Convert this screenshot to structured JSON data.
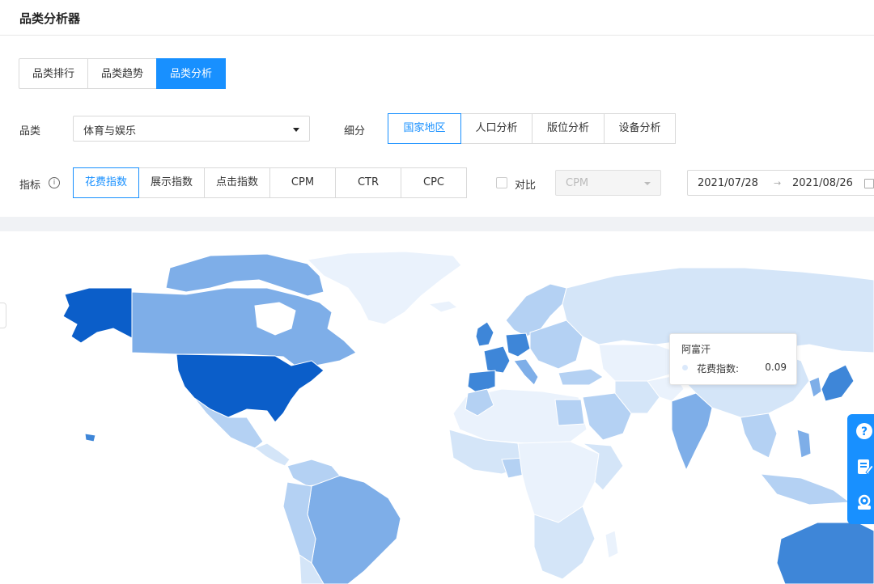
{
  "header": {
    "title": "品类分析器"
  },
  "tabs": [
    {
      "label": "品类排行",
      "active": false
    },
    {
      "label": "品类趋势",
      "active": false
    },
    {
      "label": "品类分析",
      "active": true
    }
  ],
  "category": {
    "label": "品类",
    "value": "体育与娱乐"
  },
  "breakdown": {
    "label": "细分",
    "options": [
      {
        "label": "国家地区",
        "active": true
      },
      {
        "label": "人口分析",
        "active": false
      },
      {
        "label": "版位分析",
        "active": false
      },
      {
        "label": "设备分析",
        "active": false
      }
    ]
  },
  "metric": {
    "label": "指标",
    "options": [
      {
        "label": "花费指数",
        "active": true
      },
      {
        "label": "展示指数",
        "active": false
      },
      {
        "label": "点击指数",
        "active": false
      },
      {
        "label": "CPM",
        "active": false
      },
      {
        "label": "CTR",
        "active": false
      },
      {
        "label": "CPC",
        "active": false
      }
    ]
  },
  "compare": {
    "label": "对比",
    "checked": false,
    "select_value": "CPM"
  },
  "date_range": {
    "start": "2021/07/28",
    "separator": "→",
    "end": "2021/08/26"
  },
  "tooltip": {
    "title": "阿富汗",
    "metric_label": "花费指数:",
    "value": "0.09"
  },
  "map_colors": {
    "darkest": "#0b5ec9",
    "dark": "#3e86d8",
    "medium": "#7eaee8",
    "light": "#b4d1f3",
    "lighter": "#d4e5f8",
    "lightest": "#eaf2fc"
  },
  "side_tools": [
    "help-icon",
    "feedback-icon",
    "support-icon"
  ],
  "colors": {
    "primary": "#1890ff"
  }
}
